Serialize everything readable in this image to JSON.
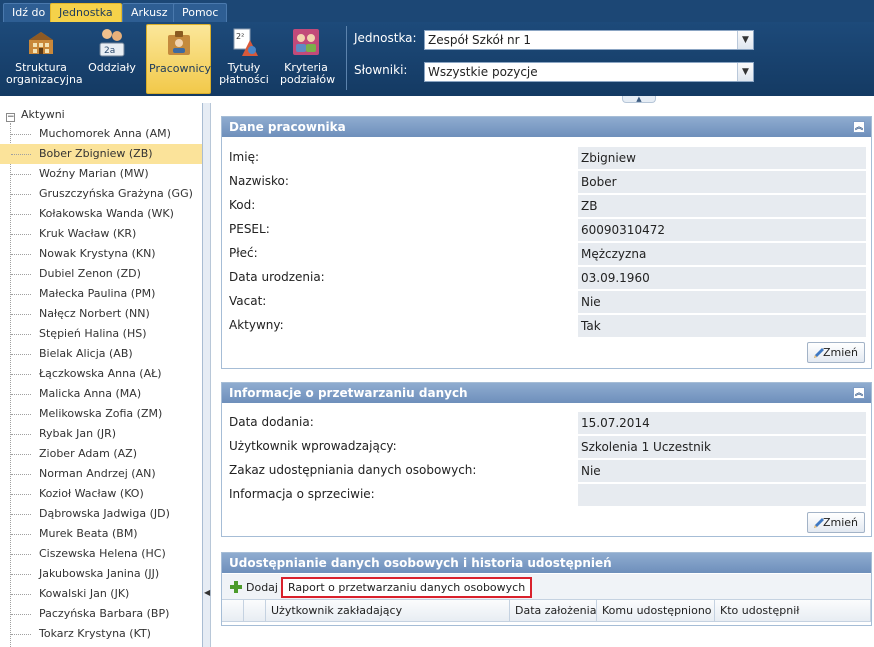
{
  "menu": {
    "tabs": [
      {
        "label": "Idź do",
        "active": false
      },
      {
        "label": "Jednostka",
        "active": true
      },
      {
        "label": "Arkusz",
        "active": false
      },
      {
        "label": "Pomoc",
        "active": false
      }
    ]
  },
  "ribbon": {
    "buttons": [
      {
        "label": "Struktura organizacyjna",
        "icon": "building-icon",
        "active": false
      },
      {
        "label": "Oddziały",
        "icon": "class-group-icon",
        "active": false
      },
      {
        "label": "Pracownicy",
        "icon": "employee-badge-icon",
        "active": true
      },
      {
        "label": "Tytuły płatności",
        "icon": "payment-title-icon",
        "active": false
      },
      {
        "label": "Kryteria podziałów",
        "icon": "criteria-people-icon",
        "active": false
      }
    ],
    "jednostka_label": "Jednostka:",
    "jednostka_value": "Zespół Szkół nr 1",
    "slowniki_label": "Słowniki:",
    "slowniki_value": "Wszystkie pozycje"
  },
  "tree": {
    "root_label": "Aktywni",
    "items": [
      "Muchomorek Anna (AM)",
      "Bober Zbigniew (ZB)",
      "Woźny Marian (MW)",
      "Gruszczyńska Grażyna (GG)",
      "Kołakowska Wanda (WK)",
      "Kruk Wacław (KR)",
      "Nowak Krystyna (KN)",
      "Dubiel Zenon (ZD)",
      "Małecka Paulina (PM)",
      "Nałęcz Norbert (NN)",
      "Stępień Halina (HS)",
      "Bielak Alicja (AB)",
      "Łączkowska Anna (AŁ)",
      "Malicka Anna (MA)",
      "Melikowska Zofia (ZM)",
      "Rybak Jan (JR)",
      "Ziober Adam (AZ)",
      "Norman Andrzej (AN)",
      "Kozioł Wacław (KO)",
      "Dąbrowska Jadwiga (JD)",
      "Murek Beata (BM)",
      "Ciszewska Helena (HC)",
      "Jakubowska Janina (JJ)",
      "Kowalski Jan (JK)",
      "Paczyńska Barbara (BP)",
      "Tokarz Krystyna (KT)"
    ],
    "selected_index": 1
  },
  "panel1": {
    "title": "Dane pracownika",
    "fields": [
      {
        "label": "Imię:",
        "value": "Zbigniew"
      },
      {
        "label": "Nazwisko:",
        "value": "Bober"
      },
      {
        "label": "Kod:",
        "value": "ZB"
      },
      {
        "label": "PESEL:",
        "value": "60090310472"
      },
      {
        "label": "Płeć:",
        "value": "Mężczyzna"
      },
      {
        "label": "Data urodzenia:",
        "value": "03.09.1960"
      },
      {
        "label": "Vacat:",
        "value": "Nie"
      },
      {
        "label": "Aktywny:",
        "value": "Tak"
      }
    ],
    "button_label": "Zmień"
  },
  "panel2": {
    "title": "Informacje o przetwarzaniu danych",
    "fields": [
      {
        "label": "Data dodania:",
        "value": "15.07.2014"
      },
      {
        "label": "Użytkownik wprowadzający:",
        "value": "Szkolenia 1 Uczestnik"
      },
      {
        "label": "Zakaz udostępniania danych osobowych:",
        "value": "Nie"
      },
      {
        "label": "Informacja o sprzeciwie:",
        "value": ""
      }
    ],
    "button_label": "Zmień"
  },
  "panel3": {
    "title": "Udostępnianie danych osobowych i historia udostępnień",
    "add_label": "Dodaj",
    "report_label": "Raport o przetwarzaniu danych osobowych",
    "columns": [
      "Użytkownik zakładający",
      "Data założenia",
      "Komu udostępniono",
      "Kto udostępnił"
    ]
  },
  "colors": {
    "header_bg": "#1c4775",
    "active_yellow": "#f5d24a",
    "panel_header": "#7b9ac4",
    "highlight_red": "#d9212c",
    "selected_row": "#fbe39a"
  }
}
